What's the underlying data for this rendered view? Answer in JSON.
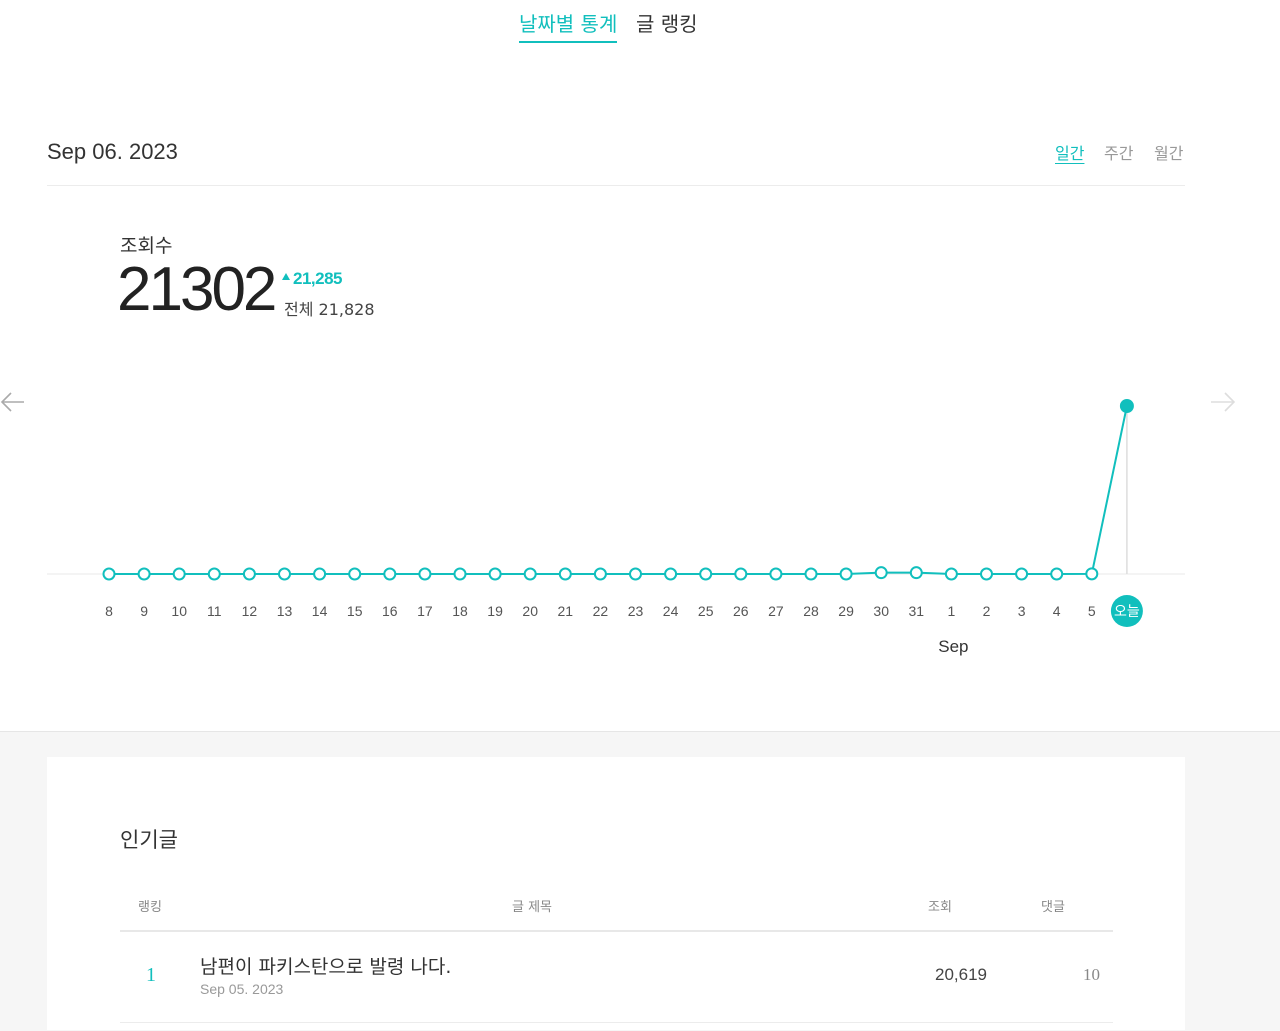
{
  "tabs": [
    {
      "label": "날짜별 통계",
      "active": true
    },
    {
      "label": "글 랭킹",
      "active": false
    }
  ],
  "date_label": "Sep 06. 2023",
  "periods": [
    {
      "label": "일간",
      "active": true
    },
    {
      "label": "주간",
      "active": false
    },
    {
      "label": "월간",
      "active": false
    }
  ],
  "metric": {
    "label": "조회수",
    "value": "21302",
    "delta": "21,285",
    "total": "전체 21,828"
  },
  "colors": {
    "accent": "#11bfbd"
  },
  "icons": {
    "prev": "arrow-left-icon",
    "next": "arrow-right-icon"
  },
  "chart_data": {
    "type": "line",
    "x": [
      "8",
      "9",
      "10",
      "11",
      "12",
      "13",
      "14",
      "15",
      "16",
      "17",
      "18",
      "19",
      "20",
      "21",
      "22",
      "23",
      "24",
      "25",
      "26",
      "27",
      "28",
      "29",
      "30",
      "31",
      "1",
      "2",
      "3",
      "4",
      "5",
      "오늘"
    ],
    "month_label": "Sep",
    "month_label_at": "1",
    "values": [
      0,
      0,
      0,
      0,
      0,
      0,
      0,
      0,
      0,
      0,
      0,
      0,
      0,
      0,
      0,
      0,
      0,
      0,
      0,
      0,
      0,
      0,
      170,
      170,
      0,
      0,
      0,
      0,
      17,
      21302
    ],
    "highlight": "오늘",
    "grid": false
  },
  "popular": {
    "title": "인기글",
    "headers": {
      "rank": "랭킹",
      "title": "글 제목",
      "views": "조회",
      "comments": "댓글"
    },
    "rows": [
      {
        "rank": "1",
        "title": "남편이 파키스탄으로 발령 나다.",
        "date": "Sep 05. 2023",
        "views": "20,619",
        "comments": "10"
      }
    ]
  }
}
